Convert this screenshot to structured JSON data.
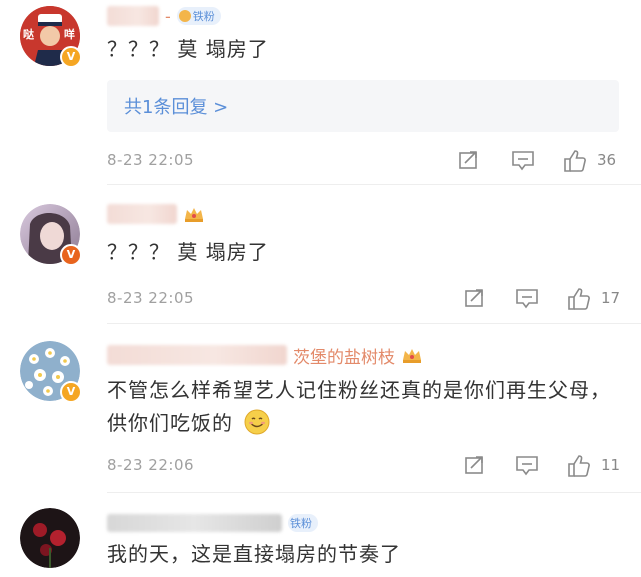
{
  "comments": [
    {
      "badge_label": "铁粉",
      "name_separator": "-",
      "text": "？？？ 莫 塌房了",
      "reply_label": "共1条回复 >",
      "timestamp": "8-23 22:05",
      "likes": "36",
      "avatar_text": [
        "哒",
        "咩"
      ]
    },
    {
      "text": "？？？ 莫 塌房了",
      "timestamp": "8-23 22:05",
      "likes": "17"
    },
    {
      "name_visible": "茨堡的盐树枝",
      "text": "不管怎么样希望艺人记住粉丝还真的是你们再生父母，供你们吃饭的",
      "emoji": "smile-emoji",
      "timestamp": "8-23 22:06",
      "likes": "11"
    },
    {
      "badge_label": "铁粉",
      "text": "我的天，这是直接塌房的节奏了"
    }
  ],
  "icons": {
    "repost": "repost-icon",
    "comment": "comment-icon",
    "like": "like-icon",
    "verified": "verified-v-icon",
    "crown": "crown-icon"
  },
  "colors": {
    "link_blue": "#5b8fd8",
    "name_orange": "#e38a6a",
    "meta_gray": "#a0a0a0",
    "verified_gold": "#f5a623"
  }
}
